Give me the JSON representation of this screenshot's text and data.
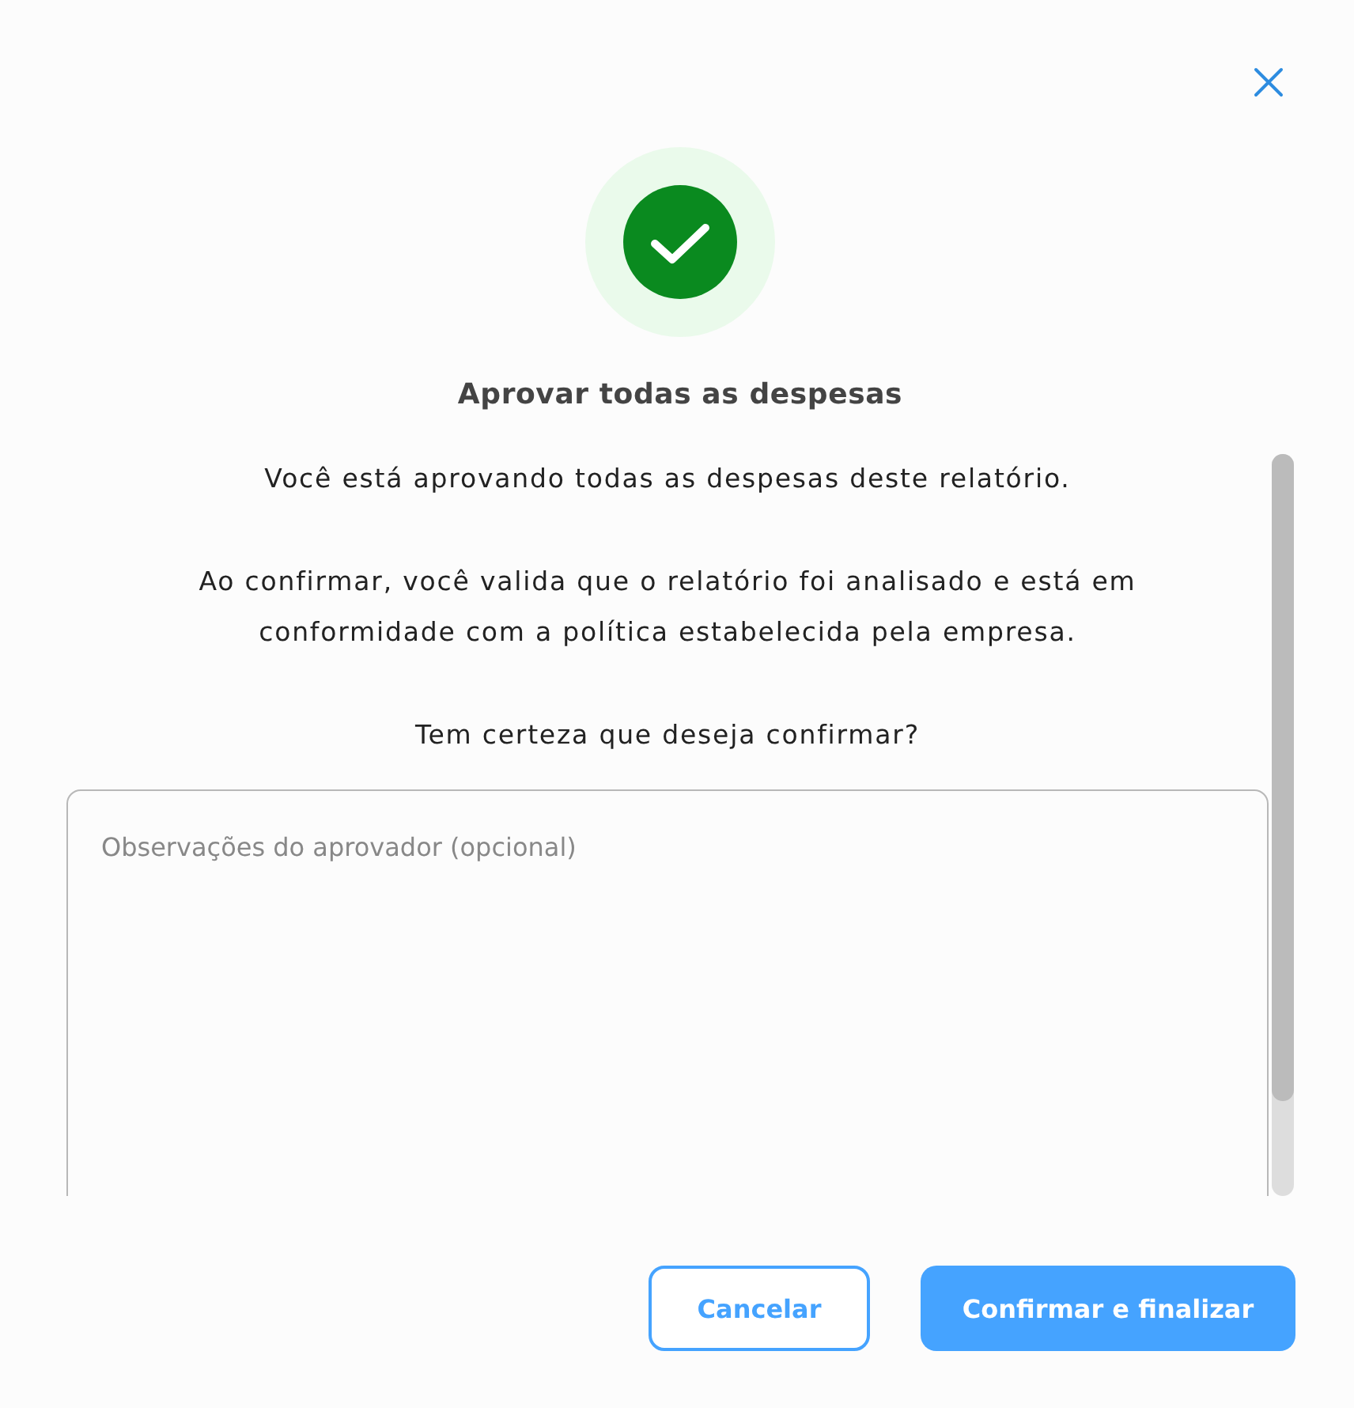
{
  "dialog": {
    "title": "Aprovar todas as despesas",
    "paragraphs": [
      "Você está aprovando todas as despesas deste relatório.",
      "Ao confirmar, você valida que o relatório foi analisado e está em conformidade com a política estabelecida pela empresa.",
      "Tem certeza que deseja confirmar?"
    ],
    "notes_field": {
      "placeholder": "Observações do aprovador (opcional)"
    },
    "buttons": [
      {
        "label": "Cancelar",
        "kind": "secondary"
      },
      {
        "label": "Confirmar e finalizar",
        "kind": "primary"
      }
    ]
  }
}
